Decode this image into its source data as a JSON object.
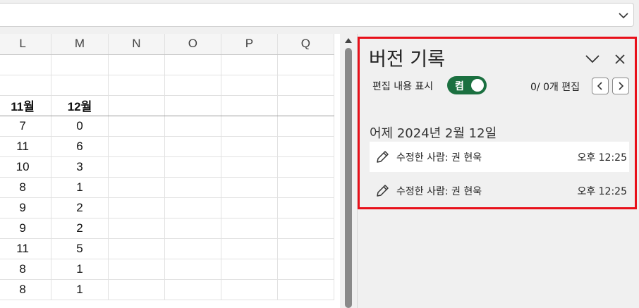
{
  "columns": [
    "L",
    "M",
    "N",
    "O",
    "P",
    "Q"
  ],
  "rows": [
    [
      "",
      "",
      "",
      "",
      "",
      ""
    ],
    [
      "",
      "",
      "",
      "",
      "",
      ""
    ],
    [
      "11월",
      "12월",
      "",
      "",
      "",
      ""
    ],
    [
      "7",
      "0",
      "",
      "",
      "",
      ""
    ],
    [
      "11",
      "6",
      "",
      "",
      "",
      ""
    ],
    [
      "10",
      "3",
      "",
      "",
      "",
      ""
    ],
    [
      "8",
      "1",
      "",
      "",
      "",
      ""
    ],
    [
      "9",
      "2",
      "",
      "",
      "",
      ""
    ],
    [
      "9",
      "2",
      "",
      "",
      "",
      ""
    ],
    [
      "11",
      "5",
      "",
      "",
      "",
      ""
    ],
    [
      "8",
      "1",
      "",
      "",
      "",
      ""
    ],
    [
      "8",
      "1",
      "",
      "",
      "",
      ""
    ]
  ],
  "panel": {
    "title": "버전 기록",
    "show_changes_label": "편집 내용 표시",
    "toggle_text": "켬",
    "edit_count": "0/ 0개 편집",
    "date_heading": "어제 2024년 2월 12일",
    "entries": [
      {
        "who": "수정한 사람: 권 현욱",
        "time": "오후 12:25"
      },
      {
        "who": "수정한 사람: 권 현욱",
        "time": "오후 12:25"
      }
    ]
  },
  "colors": {
    "highlight_border": "#e8101a",
    "toggle_on": "#1b7040"
  },
  "icons": [
    "chevron-down-icon",
    "close-icon",
    "chevron-left-icon",
    "chevron-right-icon",
    "pencil-icon"
  ]
}
